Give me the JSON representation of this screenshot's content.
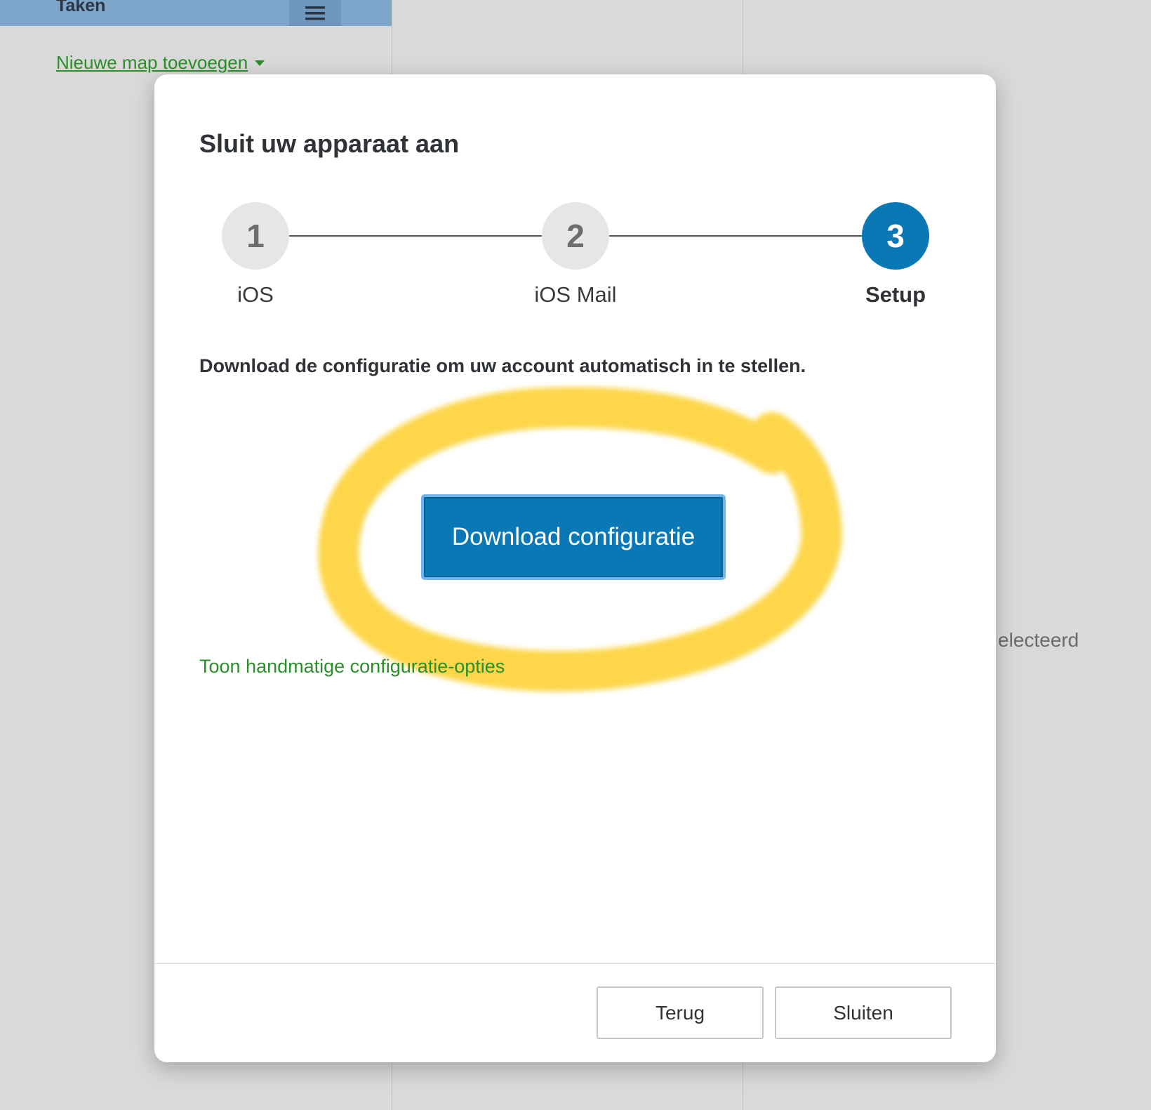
{
  "app": {
    "top_title": "Taken",
    "new_folder_link": "Nieuwe map toevoegen",
    "selected_text": "electeerd"
  },
  "modal": {
    "title": "Sluit uw apparaat aan",
    "steps": [
      {
        "number": "1",
        "label": "iOS",
        "active": false
      },
      {
        "number": "2",
        "label": "iOS Mail",
        "active": false
      },
      {
        "number": "3",
        "label": "Setup",
        "active": true
      }
    ],
    "description": "Download de configuratie om uw account automatisch in te stellen.",
    "download_button": "Download configuratie",
    "manual_link": "Toon handmatige configuratie-opties",
    "back_button": "Terug",
    "close_button": "Sluiten"
  },
  "colors": {
    "primary": "#0b78b6",
    "link_green": "#2a8f2a",
    "highlight_yellow": "#fdd33a",
    "header_blue": "#7ea6cb"
  },
  "icons": {
    "menu": "hamburger-menu-icon",
    "dropdown": "caret-down-icon"
  }
}
